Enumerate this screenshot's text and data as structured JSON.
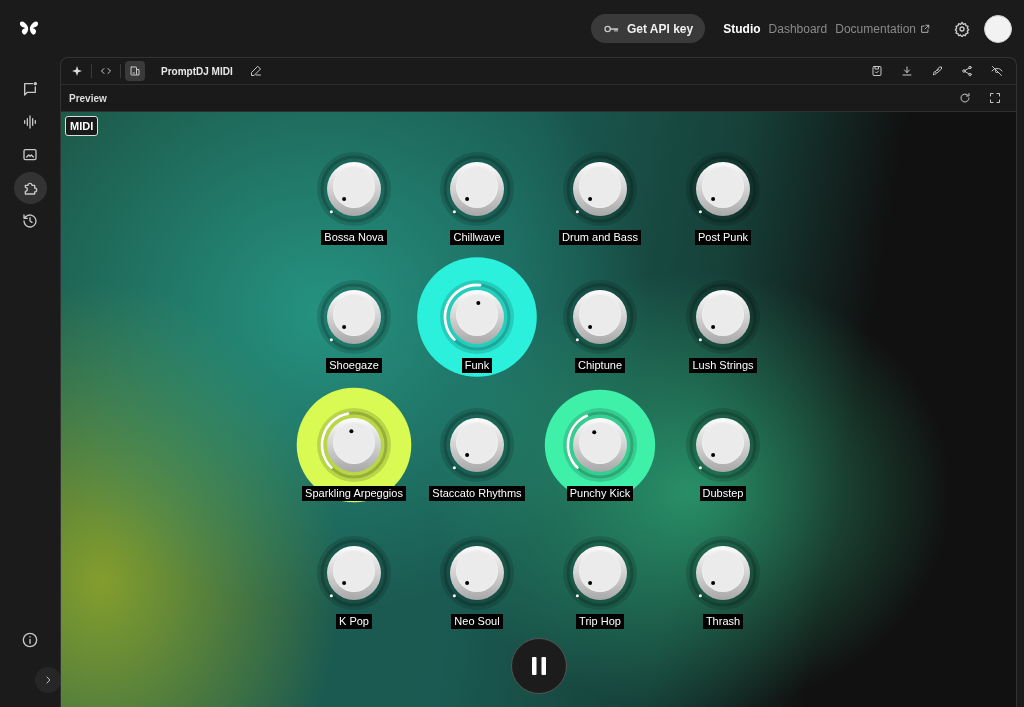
{
  "header": {
    "api_button": "Get API key",
    "nav": [
      {
        "label": "Studio",
        "selected": true,
        "external": false
      },
      {
        "label": "Dashboard",
        "selected": false,
        "external": false
      },
      {
        "label": "Documentation",
        "selected": false,
        "external": true
      }
    ]
  },
  "rail": {
    "items": [
      {
        "kind": "chat",
        "selected": false
      },
      {
        "kind": "audio",
        "selected": false
      },
      {
        "kind": "image",
        "selected": false
      },
      {
        "kind": "apps",
        "selected": true
      },
      {
        "kind": "history",
        "selected": false
      }
    ]
  },
  "toolbar": {
    "modes": [
      {
        "kind": "sparkle",
        "selected": false
      },
      {
        "kind": "code",
        "selected": false
      },
      {
        "kind": "preview",
        "selected": true
      }
    ],
    "title": "PromptDJ MIDI"
  },
  "preview": {
    "title": "Preview",
    "midi_button": "MIDI",
    "playing": true,
    "knobs": [
      {
        "label": "Bossa Nova"
      },
      {
        "label": "Chillwave"
      },
      {
        "label": "Drum and Bass"
      },
      {
        "label": "Post Punk"
      },
      {
        "label": "Shoegaze"
      },
      {
        "label": "Funk",
        "level": 0.52,
        "color": "#2af0dc"
      },
      {
        "label": "Chiptune"
      },
      {
        "label": "Lush Strings"
      },
      {
        "label": "Sparkling Arpeggios",
        "level": 0.46,
        "color": "#d8fa52"
      },
      {
        "label": "Staccato Rhythms"
      },
      {
        "label": "Punchy Kick",
        "level": 0.41,
        "color": "#3ef0a8"
      },
      {
        "label": "Dubstep"
      },
      {
        "label": "K Pop"
      },
      {
        "label": "Neo Soul"
      },
      {
        "label": "Trip Hop"
      },
      {
        "label": "Thrash"
      }
    ]
  }
}
